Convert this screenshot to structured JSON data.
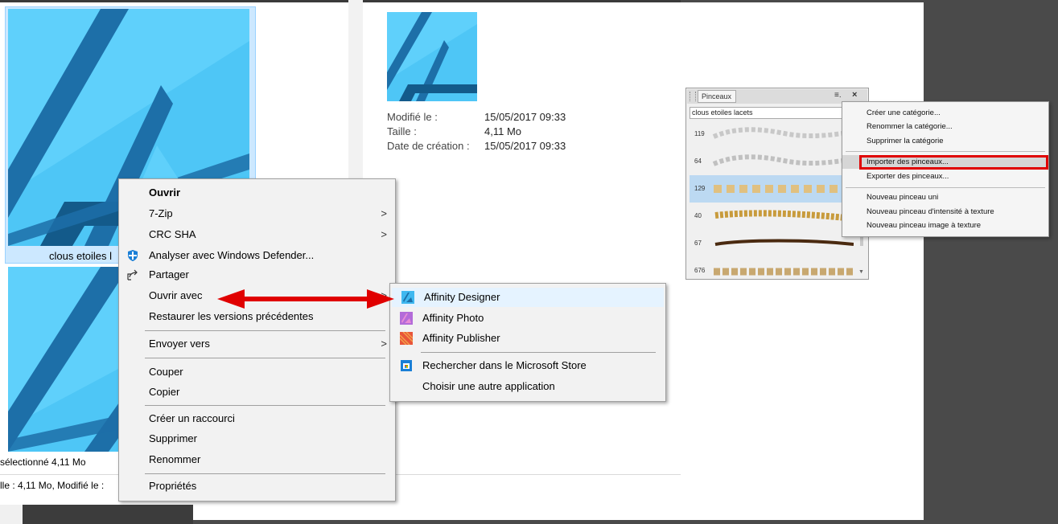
{
  "explorer": {
    "file_caption": "clous etoiles l",
    "status_selected": "sélectionné  4,11 Mo",
    "status_details": "lle : 4,11 Mo, Modifié le :"
  },
  "preview": {
    "modified_label": "Modifié le :",
    "modified_value": "15/05/2017 09:33",
    "size_label": "Taille :",
    "size_value": "4,11 Mo",
    "created_label": "Date de création :",
    "created_value": "15/05/2017 09:33"
  },
  "context_menu": {
    "open": "Ouvrir",
    "zip": "7-Zip",
    "crc": "CRC SHA",
    "defender": "Analyser avec Windows Defender...",
    "share": "Partager",
    "open_with": "Ouvrir avec",
    "restore": "Restaurer les versions précédentes",
    "send_to": "Envoyer vers",
    "cut": "Couper",
    "copy": "Copier",
    "shortcut": "Créer un raccourci",
    "delete": "Supprimer",
    "rename": "Renommer",
    "properties": "Propriétés"
  },
  "open_with_menu": {
    "designer": "Affinity Designer",
    "photo": "Affinity Photo",
    "publisher": "Affinity Publisher",
    "store": "Rechercher dans le Microsoft Store",
    "other": "Choisir une autre application"
  },
  "brushes_panel": {
    "tab": "Pinceaux",
    "category": "clous etoiles lacets",
    "rows": [
      "119",
      "64",
      "129",
      "40",
      "67",
      "676"
    ]
  },
  "brushes_menu": {
    "create_category": "Créer une catégorie...",
    "rename_category": "Renommer la catégorie...",
    "delete_category": "Supprimer la catégorie",
    "import": "Importer des pinceaux...",
    "export": "Exporter des pinceaux...",
    "new_solid": "Nouveau pinceau uni",
    "new_intensity": "Nouveau pinceau d'intensité à texture",
    "new_image": "Nouveau pinceau image à texture"
  },
  "colors": {
    "accent_red": "#e00000",
    "selection": "#cce8ff",
    "affinity_blue": "#3fb8f0"
  }
}
